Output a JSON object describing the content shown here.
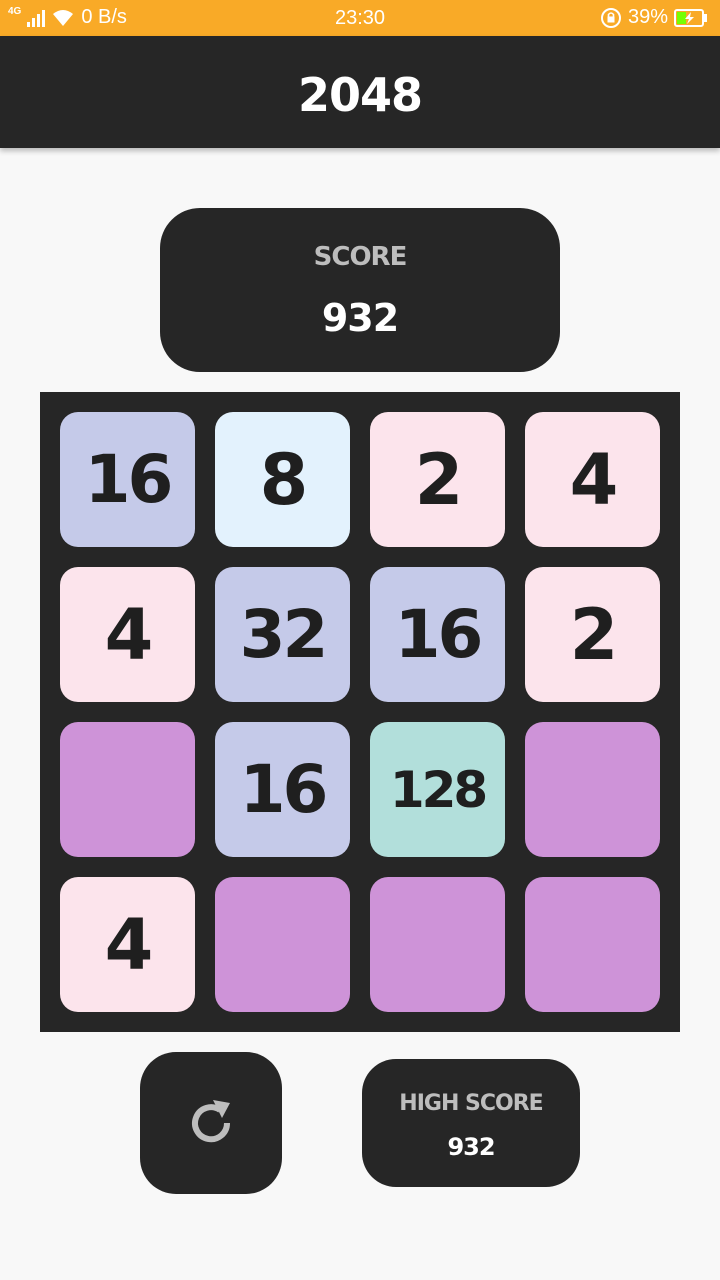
{
  "status_bar": {
    "network_type": "4G",
    "data_speed": "0 B/s",
    "time": "23:30",
    "battery_percent": "39%",
    "battery_level": 0.39,
    "icons": [
      "signal-icon",
      "wifi-icon",
      "rotation-lock-icon",
      "battery-charging-icon"
    ]
  },
  "app_bar": {
    "title": "2048"
  },
  "score": {
    "label": "SCORE",
    "value": "932"
  },
  "board": {
    "colors": {
      "empty": "#ce93d8",
      "2": "#fce4ec",
      "4": "#fce4ec",
      "8": "#e3f2fd",
      "16": "#c5cae9",
      "32": "#c5cae9",
      "128": "#b2dfdb"
    },
    "tiles": [
      "16",
      "8",
      "2",
      "4",
      "4",
      "32",
      "16",
      "2",
      "",
      "16",
      "128",
      "",
      "4",
      "",
      "",
      ""
    ]
  },
  "controls": {
    "restart_icon": "refresh-icon",
    "high_score_label": "HIGH SCORE",
    "high_score_value": "932"
  }
}
